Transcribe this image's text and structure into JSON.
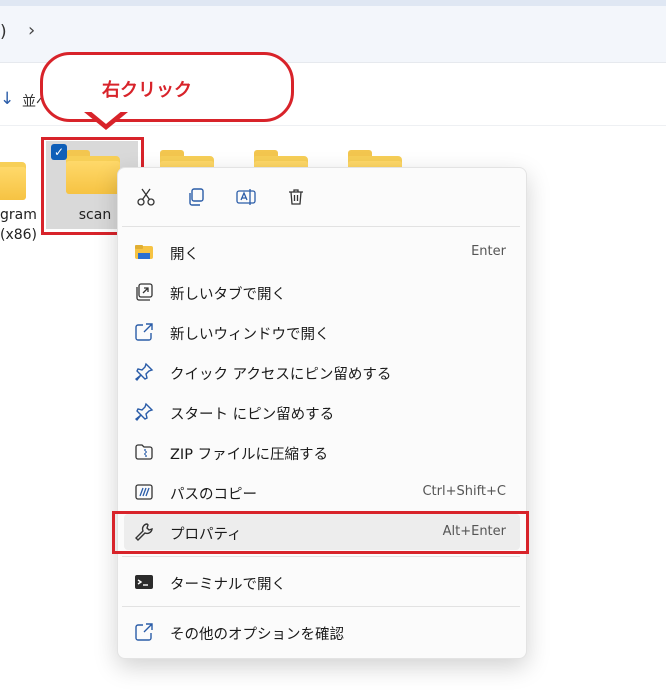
{
  "address_bar": {
    "paren": ")",
    "chevron": "›"
  },
  "command_bar": {
    "sort_label": "並べ"
  },
  "annotation": {
    "callout_text": "右クリック",
    "color": "#d8232a"
  },
  "folders": {
    "left_label_line1": "gram",
    "left_label_line2": "(x86)",
    "selected_label": "scan"
  },
  "context_menu": {
    "toolbar": [
      {
        "icon": "cut-icon"
      },
      {
        "icon": "copy-icon"
      },
      {
        "icon": "rename-icon"
      },
      {
        "icon": "delete-icon"
      }
    ],
    "items": [
      {
        "label": "開く",
        "shortcut": "Enter",
        "icon": "folder-open-icon"
      },
      {
        "label": "新しいタブで開く",
        "shortcut": "",
        "icon": "new-tab-icon"
      },
      {
        "label": "新しいウィンドウで開く",
        "shortcut": "",
        "icon": "new-window-icon"
      },
      {
        "label": "クイック アクセスにピン留めする",
        "shortcut": "",
        "icon": "pin-icon"
      },
      {
        "label": "スタート にピン留めする",
        "shortcut": "",
        "icon": "pin-icon"
      },
      {
        "label": "ZIP ファイルに圧縮する",
        "shortcut": "",
        "icon": "zip-icon"
      },
      {
        "label": "パスのコピー",
        "shortcut": "Ctrl+Shift+C",
        "icon": "copy-path-icon"
      },
      {
        "label": "プロパティ",
        "shortcut": "Alt+Enter",
        "icon": "wrench-icon"
      },
      {
        "label": "ターミナルで開く",
        "shortcut": "",
        "icon": "terminal-icon"
      },
      {
        "label": "その他のオプションを確認",
        "shortcut": "",
        "icon": "more-options-icon"
      }
    ]
  }
}
